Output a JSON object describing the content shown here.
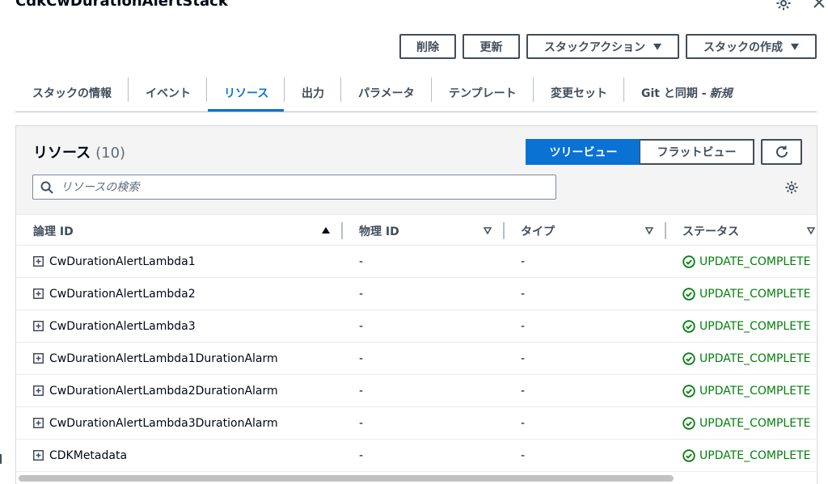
{
  "stack": {
    "title": "CdkCwDurationAlertStack"
  },
  "actions": {
    "delete": "削除",
    "update": "更新",
    "stack_actions": "スタックアクション",
    "create_stack": "スタックの作成"
  },
  "tabs": [
    {
      "label": "スタックの情報"
    },
    {
      "label": "イベント"
    },
    {
      "label": "リソース",
      "active": true
    },
    {
      "label": "出力"
    },
    {
      "label": "パラメータ"
    },
    {
      "label": "テンプレート"
    },
    {
      "label": "変更セット"
    },
    {
      "label": "Git と同期 -",
      "suffix": "新規"
    }
  ],
  "resources": {
    "title": "リソース",
    "count": "(10)",
    "view_toggle": {
      "tree": "ツリービュー",
      "flat": "フラットビュー",
      "selected": "tree"
    },
    "search_placeholder": "リソースの検索",
    "columns": [
      "論理 ID",
      "物理 ID",
      "タイプ",
      "ステータス"
    ],
    "rows": [
      {
        "logical_id": "CwDurationAlertLambda1",
        "physical_id": "-",
        "type": "-",
        "status": "UPDATE_COMPLETE"
      },
      {
        "logical_id": "CwDurationAlertLambda2",
        "physical_id": "-",
        "type": "-",
        "status": "UPDATE_COMPLETE"
      },
      {
        "logical_id": "CwDurationAlertLambda3",
        "physical_id": "-",
        "type": "-",
        "status": "UPDATE_COMPLETE"
      },
      {
        "logical_id": "CwDurationAlertLambda1DurationAlarm",
        "physical_id": "-",
        "type": "-",
        "status": "UPDATE_COMPLETE"
      },
      {
        "logical_id": "CwDurationAlertLambda2DurationAlarm",
        "physical_id": "-",
        "type": "-",
        "status": "UPDATE_COMPLETE"
      },
      {
        "logical_id": "CwDurationAlertLambda3DurationAlarm",
        "physical_id": "-",
        "type": "-",
        "status": "UPDATE_COMPLETE"
      },
      {
        "logical_id": "CDKMetadata",
        "physical_id": "-",
        "type": "-",
        "status": "UPDATE_COMPLETE"
      }
    ]
  },
  "colors": {
    "accent": "#0972d3",
    "success": "#037f0c",
    "text": "#000716",
    "secondary_text": "#414d5c"
  },
  "icons": [
    "gear-icon",
    "close-icon",
    "caret-down-icon",
    "refresh-icon",
    "search-icon",
    "expand-icon",
    "sort-ascending-icon",
    "sort-descending-icon",
    "status-success-icon"
  ]
}
